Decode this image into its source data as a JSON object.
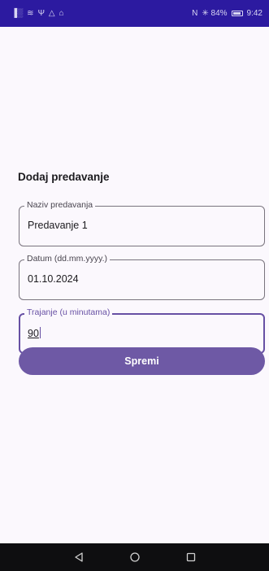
{
  "status_bar": {
    "left_icons": [
      "sim-signal-icon",
      "wifi-icon",
      "usb-icon",
      "warning-icon",
      "notification-icon"
    ],
    "left_glyphs": [
      "▐░",
      "≋",
      "Ψ",
      "△",
      "⌂"
    ],
    "nfc_glyph": "N",
    "battery_text": "✳ 84%",
    "time": "9:42"
  },
  "form": {
    "title": "Dodaj predavanje",
    "fields": [
      {
        "label": "Naziv predavanja",
        "value": "Predavanje 1"
      },
      {
        "label": "Datum (dd.mm.yyyy.)",
        "value": "01.10.2024"
      },
      {
        "label": "Trajanje (u minutama)",
        "value": "90"
      }
    ],
    "save_label": "Spremi"
  },
  "colors": {
    "status_bar": "#2c1aa0",
    "accent": "#6750a4",
    "button": "#6e59a5",
    "background": "#fbf8fd",
    "nav_bar": "#0e0e10"
  },
  "nav_bar": {
    "buttons": [
      "back-triangle-icon",
      "home-circle-icon",
      "recents-square-icon"
    ]
  }
}
